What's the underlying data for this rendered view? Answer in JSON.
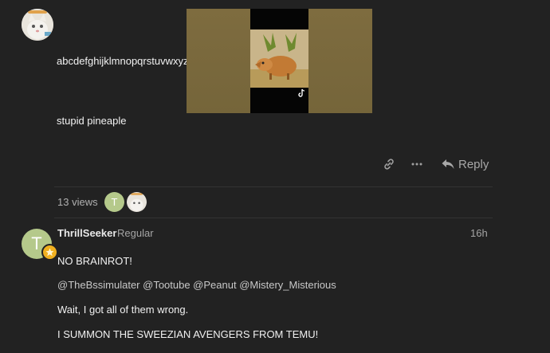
{
  "post1": {
    "line1": "abcdefghijklmnopqrstuvwxyz",
    "line2": "stupid pineaple"
  },
  "actions": {
    "link_icon": "link-icon",
    "more_icon": "more-icon",
    "reply_label": "Reply"
  },
  "stats": {
    "views_text": "13 views",
    "participant_initial": "T"
  },
  "post2": {
    "avatar_initial": "T",
    "username": "ThrillSeeker",
    "user_title": "Regular",
    "time": "16h",
    "line1": "NO BRAINROT!",
    "mentions": "@TheBssimulater @Tootube @Peanut @Mistery_Misterious",
    "line3": "Wait, I got all of them wrong.",
    "line4": "I SUMMON THE SWEEZIAN AVENGERS FROM TEMU!"
  },
  "colors": {
    "background": "#222222",
    "avatar_green": "#b5c98b",
    "badge_gold": "#f0b020"
  }
}
